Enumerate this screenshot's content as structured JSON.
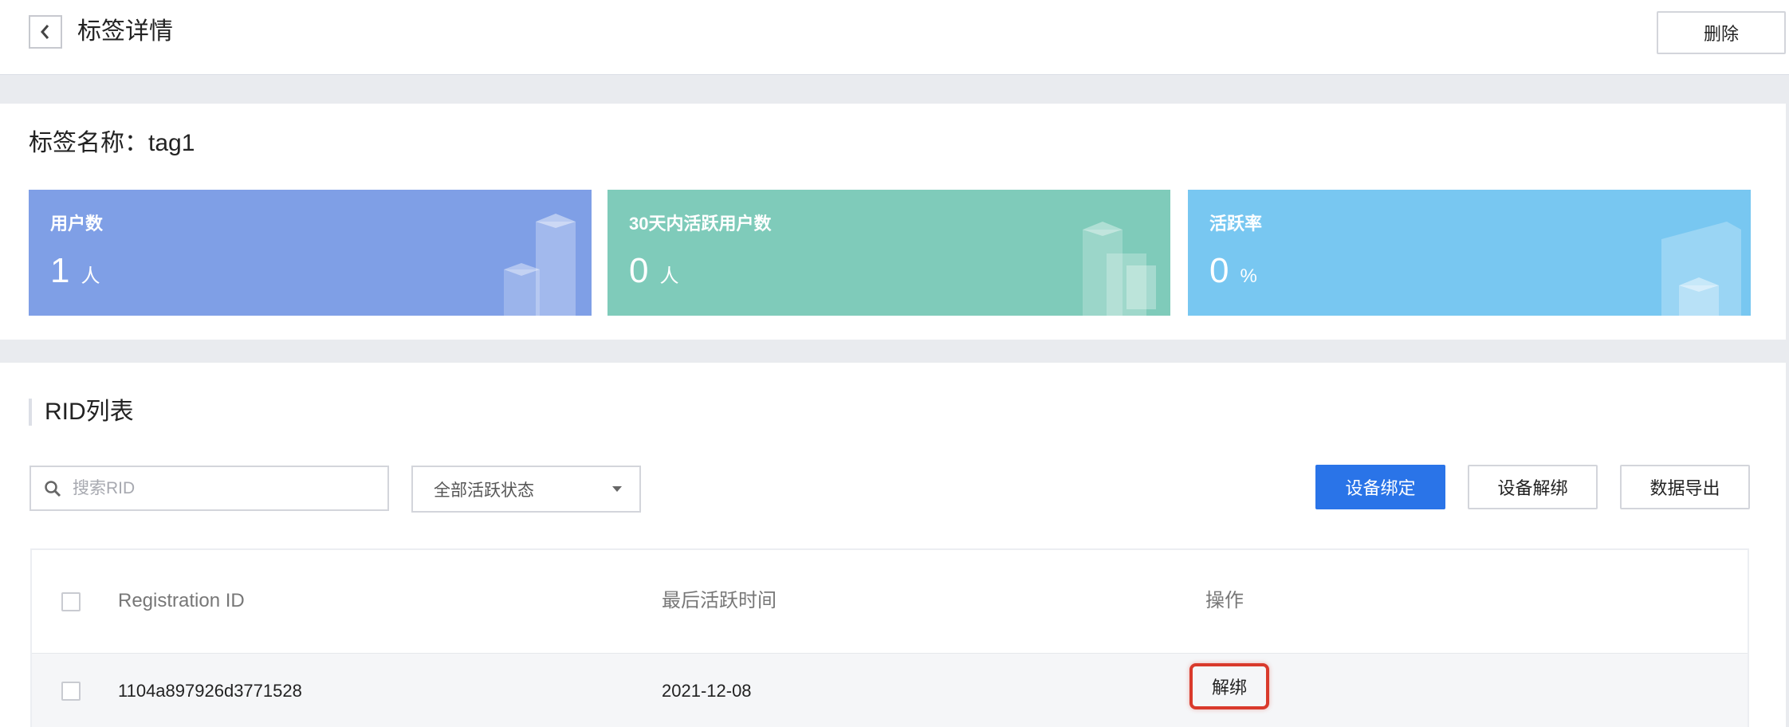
{
  "header": {
    "title": "标签详情",
    "delete_label": "删除"
  },
  "tag": {
    "name_label": "标签名称：",
    "name_value": "tag1"
  },
  "stats": [
    {
      "label": "用户数",
      "value": "1",
      "unit": "人",
      "color": "#7f9fe6"
    },
    {
      "label": "30天内活跃用户数",
      "value": "0",
      "unit": "人",
      "color": "#7fcbba"
    },
    {
      "label": "活跃率",
      "value": "0",
      "unit": "%",
      "color": "#78c7f1"
    }
  ],
  "rid_list": {
    "title": "RID列表",
    "search_placeholder": "搜索RID",
    "status_filter": "全部活跃状态",
    "bind_label": "设备绑定",
    "unbind_label": "设备解绑",
    "export_label": "数据导出",
    "columns": [
      "Registration ID",
      "最后活跃时间",
      "操作"
    ],
    "rows": [
      {
        "registration_id": "1104a897926d3771528",
        "last_active": "2021-12-08",
        "action": "解绑"
      }
    ]
  },
  "icons": {
    "back": "chevron-left-icon",
    "search": "search-icon",
    "dropdown": "caret-down-icon",
    "card_decoration": "cubes-icon"
  },
  "colors": {
    "primary": "#2a74e8",
    "highlight": "#d93a2c"
  }
}
